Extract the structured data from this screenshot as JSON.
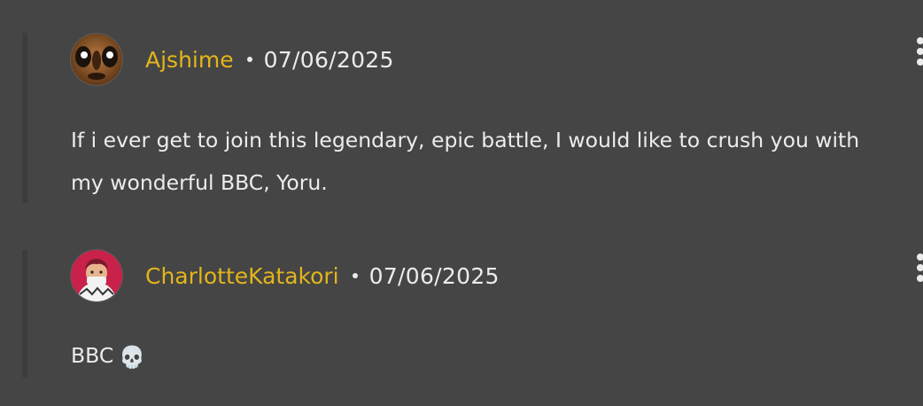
{
  "comments": [
    {
      "author": "Ajshime",
      "date": "07/06/2025",
      "body_lines": [
        "If i ever get to join this legendary, epic battle, I would like to crush you with",
        "my wonderful BBC, Yoru."
      ],
      "avatar_icon": "goofy-face-avatar"
    },
    {
      "author": "CharlotteKatakori",
      "date": "07/06/2025",
      "body_text": "BBC",
      "body_emoji": "💀",
      "avatar_icon": "anime-character-avatar"
    }
  ],
  "colors": {
    "background": "#454545",
    "author": "#e3b51b",
    "text": "#ececec",
    "thread_line": "#3d3d3d"
  }
}
